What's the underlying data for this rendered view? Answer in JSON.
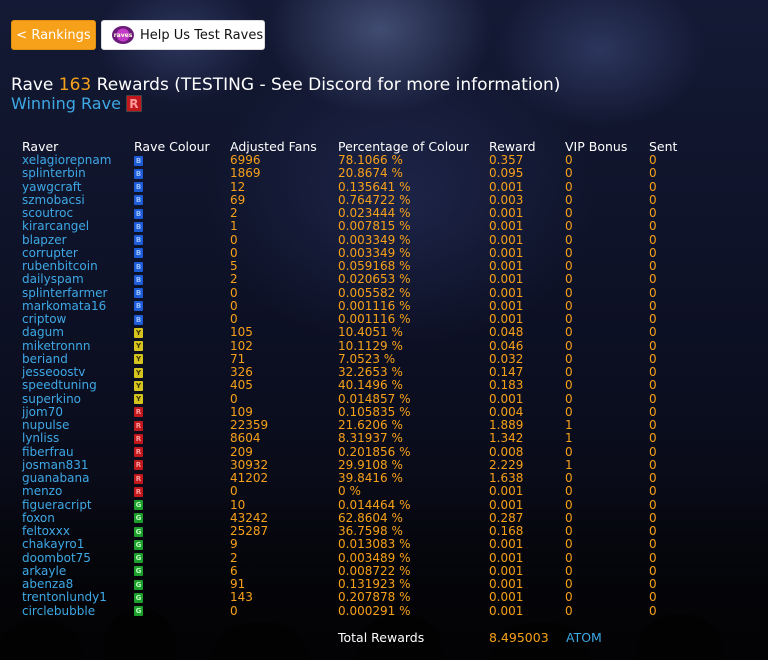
{
  "nav": {
    "rankings_label": "< Rankings",
    "help_label": "Help Us Test Raves",
    "help_logo_text": "raves"
  },
  "heading": {
    "prefix": "Rave",
    "rave_number": "163",
    "suffix": "Rewards (TESTING - See Discord for more information)",
    "winning_label": "Winning Rave",
    "winning_colour": "R"
  },
  "columns": [
    "Raver",
    "Rave Colour",
    "Adjusted Fans",
    "Percentage of Colour",
    "Reward",
    "VIP Bonus",
    "Sent"
  ],
  "rows": [
    {
      "raver": "xelagiorepnam",
      "colour": "B",
      "fans": "6996",
      "pct": "78.1066 %",
      "reward": "0.357",
      "vip": "0",
      "sent": "0"
    },
    {
      "raver": "splinterbin",
      "colour": "B",
      "fans": "1869",
      "pct": "20.8674 %",
      "reward": "0.095",
      "vip": "0",
      "sent": "0"
    },
    {
      "raver": "yawgcraft",
      "colour": "B",
      "fans": "12",
      "pct": "0.135641 %",
      "reward": "0.001",
      "vip": "0",
      "sent": "0"
    },
    {
      "raver": "szmobacsi",
      "colour": "B",
      "fans": "69",
      "pct": "0.764722 %",
      "reward": "0.003",
      "vip": "0",
      "sent": "0"
    },
    {
      "raver": "scoutroc",
      "colour": "B",
      "fans": "2",
      "pct": "0.023444 %",
      "reward": "0.001",
      "vip": "0",
      "sent": "0"
    },
    {
      "raver": "kirarcangel",
      "colour": "B",
      "fans": "1",
      "pct": "0.007815 %",
      "reward": "0.001",
      "vip": "0",
      "sent": "0"
    },
    {
      "raver": "blapzer",
      "colour": "B",
      "fans": "0",
      "pct": "0.003349 %",
      "reward": "0.001",
      "vip": "0",
      "sent": "0"
    },
    {
      "raver": "corrupter",
      "colour": "B",
      "fans": "0",
      "pct": "0.003349 %",
      "reward": "0.001",
      "vip": "0",
      "sent": "0"
    },
    {
      "raver": "rubenbitcoin",
      "colour": "B",
      "fans": "5",
      "pct": "0.059168 %",
      "reward": "0.001",
      "vip": "0",
      "sent": "0"
    },
    {
      "raver": "dailyspam",
      "colour": "B",
      "fans": "2",
      "pct": "0.020653 %",
      "reward": "0.001",
      "vip": "0",
      "sent": "0"
    },
    {
      "raver": "splinterfarmer",
      "colour": "B",
      "fans": "0",
      "pct": "0.005582 %",
      "reward": "0.001",
      "vip": "0",
      "sent": "0"
    },
    {
      "raver": "markomata16",
      "colour": "B",
      "fans": "0",
      "pct": "0.001116 %",
      "reward": "0.001",
      "vip": "0",
      "sent": "0"
    },
    {
      "raver": "criptow",
      "colour": "B",
      "fans": "0",
      "pct": "0.001116 %",
      "reward": "0.001",
      "vip": "0",
      "sent": "0"
    },
    {
      "raver": "dagum",
      "colour": "Y",
      "fans": "105",
      "pct": "10.4051 %",
      "reward": "0.048",
      "vip": "0",
      "sent": "0"
    },
    {
      "raver": "miketronnn",
      "colour": "Y",
      "fans": "102",
      "pct": "10.1129 %",
      "reward": "0.046",
      "vip": "0",
      "sent": "0"
    },
    {
      "raver": "beriand",
      "colour": "Y",
      "fans": "71",
      "pct": "7.0523 %",
      "reward": "0.032",
      "vip": "0",
      "sent": "0"
    },
    {
      "raver": "jesseoostv",
      "colour": "Y",
      "fans": "326",
      "pct": "32.2653 %",
      "reward": "0.147",
      "vip": "0",
      "sent": "0"
    },
    {
      "raver": "speedtuning",
      "colour": "Y",
      "fans": "405",
      "pct": "40.1496 %",
      "reward": "0.183",
      "vip": "0",
      "sent": "0"
    },
    {
      "raver": "superkino",
      "colour": "Y",
      "fans": "0",
      "pct": "0.014857 %",
      "reward": "0.001",
      "vip": "0",
      "sent": "0"
    },
    {
      "raver": "jjom70",
      "colour": "R",
      "fans": "109",
      "pct": "0.105835 %",
      "reward": "0.004",
      "vip": "0",
      "sent": "0"
    },
    {
      "raver": "nupulse",
      "colour": "R",
      "fans": "22359",
      "pct": "21.6206 %",
      "reward": "1.889",
      "vip": "1",
      "sent": "0"
    },
    {
      "raver": "lynliss",
      "colour": "R",
      "fans": "8604",
      "pct": "8.31937 %",
      "reward": "1.342",
      "vip": "1",
      "sent": "0"
    },
    {
      "raver": "fiberfrau",
      "colour": "R",
      "fans": "209",
      "pct": "0.201856 %",
      "reward": "0.008",
      "vip": "0",
      "sent": "0"
    },
    {
      "raver": "josman831",
      "colour": "R",
      "fans": "30932",
      "pct": "29.9108 %",
      "reward": "2.229",
      "vip": "1",
      "sent": "0"
    },
    {
      "raver": "guanabana",
      "colour": "R",
      "fans": "41202",
      "pct": "39.8416 %",
      "reward": "1.638",
      "vip": "0",
      "sent": "0"
    },
    {
      "raver": "menzo",
      "colour": "R",
      "fans": "0",
      "pct": "0 %",
      "reward": "0.001",
      "vip": "0",
      "sent": "0"
    },
    {
      "raver": "figueracript",
      "colour": "G",
      "fans": "10",
      "pct": "0.014464 %",
      "reward": "0.001",
      "vip": "0",
      "sent": "0"
    },
    {
      "raver": "foxon",
      "colour": "G",
      "fans": "43242",
      "pct": "62.8604 %",
      "reward": "0.287",
      "vip": "0",
      "sent": "0"
    },
    {
      "raver": "feltoxxx",
      "colour": "G",
      "fans": "25287",
      "pct": "36.7598 %",
      "reward": "0.168",
      "vip": "0",
      "sent": "0"
    },
    {
      "raver": "chakayro1",
      "colour": "G",
      "fans": "9",
      "pct": "0.013083 %",
      "reward": "0.001",
      "vip": "0",
      "sent": "0"
    },
    {
      "raver": "doombot75",
      "colour": "G",
      "fans": "2",
      "pct": "0.003489 %",
      "reward": "0.001",
      "vip": "0",
      "sent": "0"
    },
    {
      "raver": "arkayle",
      "colour": "G",
      "fans": "6",
      "pct": "0.008722 %",
      "reward": "0.001",
      "vip": "0",
      "sent": "0"
    },
    {
      "raver": "abenza8",
      "colour": "G",
      "fans": "91",
      "pct": "0.131923 %",
      "reward": "0.001",
      "vip": "0",
      "sent": "0"
    },
    {
      "raver": "trentonlundy1",
      "colour": "G",
      "fans": "143",
      "pct": "0.207878 %",
      "reward": "0.001",
      "vip": "0",
      "sent": "0"
    },
    {
      "raver": "circlebubble",
      "colour": "G",
      "fans": "0",
      "pct": "0.000291 %",
      "reward": "0.001",
      "vip": "0",
      "sent": "0"
    }
  ],
  "totals": {
    "label": "Total Rewards",
    "value": "8.495003",
    "unit": "ATOM"
  },
  "colors": {
    "accent": "#f7a11a",
    "link": "#3ea8e5",
    "B": "#1e5bd6",
    "Y": "#d6c41e",
    "R": "#c0181c",
    "G": "#1d9e2d"
  }
}
